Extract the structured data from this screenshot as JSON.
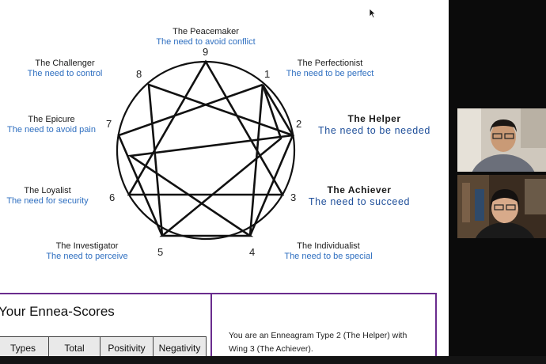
{
  "enneagram": {
    "types": [
      {
        "num": "9",
        "name": "The Peacemaker",
        "need": "The need to avoid conflict"
      },
      {
        "num": "1",
        "name": "The Perfectionist",
        "need": "The need to be perfect"
      },
      {
        "num": "2",
        "name": "The Helper",
        "need": "The need to be needed"
      },
      {
        "num": "3",
        "name": "The Achiever",
        "need": "The need to succeed"
      },
      {
        "num": "4",
        "name": "The Individualist",
        "need": "The need to be special"
      },
      {
        "num": "5",
        "name": "The Investigator",
        "need": "The need to perceive"
      },
      {
        "num": "6",
        "name": "The Loyalist",
        "need": "The need for security"
      },
      {
        "num": "7",
        "name": "The Epicure",
        "need": "The need to avoid pain"
      },
      {
        "num": "8",
        "name": "The Challenger",
        "need": "The need to control"
      }
    ]
  },
  "scores": {
    "title": "Your Ennea-Scores",
    "columns": [
      "Types",
      "Total",
      "Positivity",
      "Negativity"
    ]
  },
  "result": {
    "text": "You are an Enneagram Type 2 (The Helper) with Wing 3 (The Achiever)."
  },
  "colors": {
    "accent_purple": "#6a2c8e",
    "need_blue": "#2f6fc0",
    "highlight_blue": "#1f4f9a"
  }
}
